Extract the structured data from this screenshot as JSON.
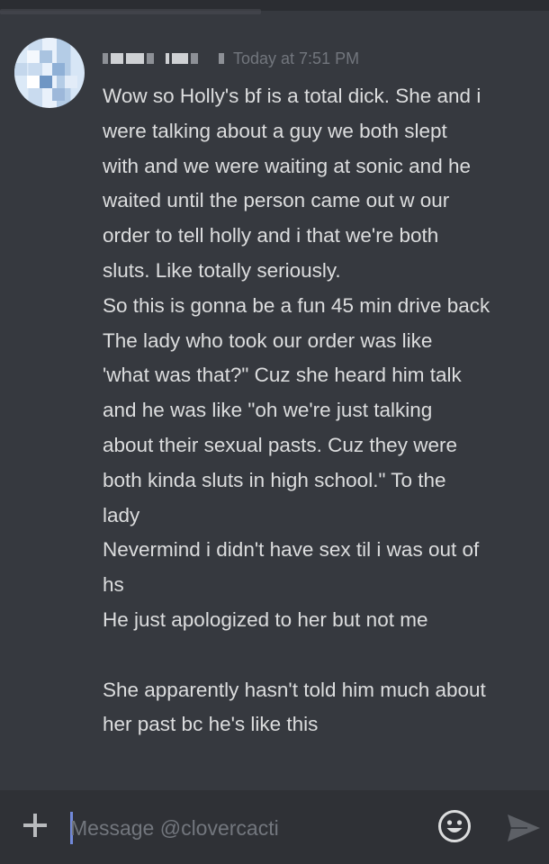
{
  "message": {
    "author_name": "",
    "timestamp": "Today at 7:51 PM",
    "lines": [
      "Wow so Holly's bf is a total dick. She and i",
      "were talking about a guy we both slept",
      "with and we were waiting at sonic and he",
      "waited until the person came out w our",
      "order to tell holly and i that we're both",
      "sluts. Like totally seriously.",
      "So this is gonna be a fun 45 min drive back",
      "The lady who took our order was like",
      "'what was that?\" Cuz she heard him talk",
      "and he was like \"oh we're just talking",
      "about their sexual pasts. Cuz they were",
      "both kinda sluts in high school.\" To the",
      "lady",
      "Nevermind i didn't have sex til i was out of",
      "hs",
      "He just apologized to her but not me",
      "",
      "She apparently hasn't told him much about",
      "her past bc he's like this"
    ]
  },
  "composer": {
    "placeholder": "Message @clovercacti",
    "value": ""
  },
  "icons": {
    "add": "plus-icon",
    "emoji": "emoji-icon",
    "send": "send-icon"
  },
  "colors": {
    "background": "#36393f",
    "composer_background": "#2f3136",
    "message_text": "#dcddde",
    "timestamp": "#72767d",
    "caret": "#7289da"
  }
}
